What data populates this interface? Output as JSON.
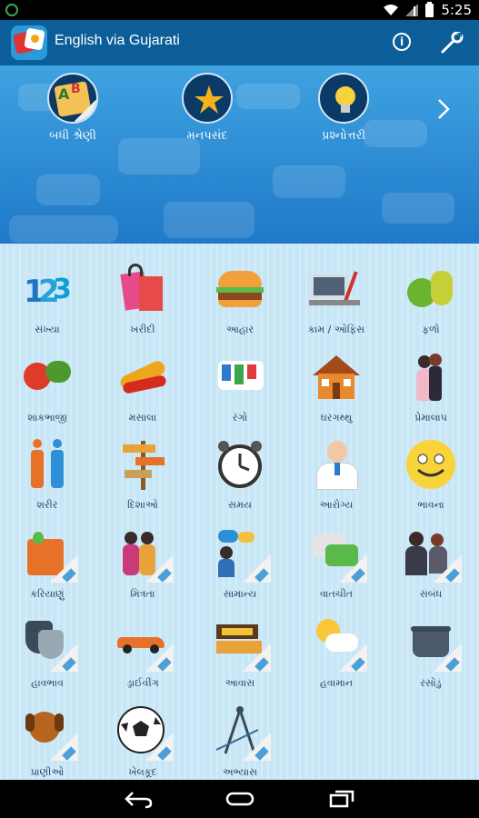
{
  "status": {
    "time": "5:25"
  },
  "appbar": {
    "title": "English via Gujarati"
  },
  "header": {
    "categories": [
      {
        "label": "બધી શ્રેણી",
        "icon": "abc-book-icon"
      },
      {
        "label": "મનપસંદ",
        "icon": "star-icon"
      },
      {
        "label": "પ્રશ્નોત્તરી",
        "icon": "lightbulb-icon"
      }
    ]
  },
  "grid": {
    "items": [
      {
        "label": "સંખ્યા",
        "icon": "numbers-icon"
      },
      {
        "label": "ખરીદી",
        "icon": "shopping-bags-icon"
      },
      {
        "label": "આહાર",
        "icon": "burger-icon"
      },
      {
        "label": "કામ / ઓફિસ",
        "icon": "office-desk-icon"
      },
      {
        "label": "ફળો",
        "icon": "fruits-icon"
      },
      {
        "label": "શાકભાજી",
        "icon": "vegetables-icon"
      },
      {
        "label": "મસાલા",
        "icon": "pepper-icon"
      },
      {
        "label": "રંગો",
        "icon": "paint-icon"
      },
      {
        "label": "ઘરગથ્થુ",
        "icon": "house-icon"
      },
      {
        "label": "પ્રેમાલાપ",
        "icon": "couple-icon"
      },
      {
        "label": "શરીર",
        "icon": "body-icon"
      },
      {
        "label": "દિશાઓ",
        "icon": "signpost-icon"
      },
      {
        "label": "સમય",
        "icon": "alarm-clock-icon"
      },
      {
        "label": "આરોગ્ય",
        "icon": "doctor-icon"
      },
      {
        "label": "ભાવના",
        "icon": "smiley-icon"
      },
      {
        "label": "કરિયાણું",
        "icon": "grocery-bag-icon"
      },
      {
        "label": "મિત્રતા",
        "icon": "friends-icon"
      },
      {
        "label": "સામાન્ય",
        "icon": "chat-person-icon"
      },
      {
        "label": "વાતચીત",
        "icon": "chat-bubbles-icon"
      },
      {
        "label": "સંબંધ",
        "icon": "family-icon"
      },
      {
        "label": "હાવભાવ",
        "icon": "masks-icon"
      },
      {
        "label": "ડ્રાઈવીંગ",
        "icon": "car-icon"
      },
      {
        "label": "આવાસ",
        "icon": "bed-icon"
      },
      {
        "label": "હવામાન",
        "icon": "weather-icon"
      },
      {
        "label": "રસોડું",
        "icon": "cooking-pot-icon"
      },
      {
        "label": "પ્રાણીઓ",
        "icon": "dog-icon"
      },
      {
        "label": "ખેલકૂદ",
        "icon": "football-icon"
      },
      {
        "label": "અભ્યાસ",
        "icon": "compass-icon"
      }
    ]
  },
  "colors": {
    "appbar": "#0c5e98",
    "band": "#2e8fd8",
    "grid": "#c7e6f6"
  }
}
